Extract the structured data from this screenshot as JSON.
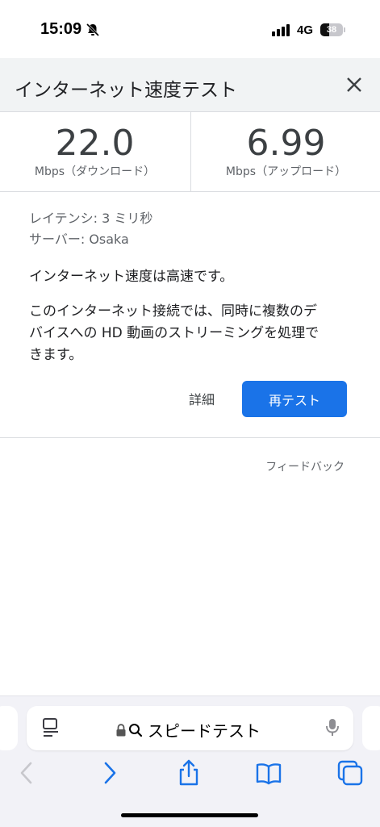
{
  "status_bar": {
    "time": "15:09",
    "network": "4G",
    "battery": "38",
    "battery_level": 0.38
  },
  "header": {
    "title": "インターネット速度テスト"
  },
  "results": {
    "download": {
      "value": "22.0",
      "unit": "Mbps（ダウンロード）"
    },
    "upload": {
      "value": "6.99",
      "unit": "Mbps（アップロード）"
    }
  },
  "info": {
    "latency": "レイテンシ: 3 ミリ秒",
    "server": "サーバー: Osaka",
    "summary": "インターネット速度は高速です。",
    "description_lines": [
      "このインターネット接続では、同時に複数のデ",
      "バイスへの HD 動画のストリーミングを処理で",
      "きます。"
    ]
  },
  "actions": {
    "details": "詳細",
    "retest": "再テスト",
    "feedback": "フィードバック"
  },
  "browser": {
    "address_text": "スピードテスト"
  },
  "colors": {
    "accent": "#1a73e8",
    "header_bg": "#f1f3f4",
    "ios_blue": "#1a73e8"
  },
  "icons": [
    "bell-slash-icon",
    "close-icon",
    "reader-icon",
    "lock-icon",
    "search-icon",
    "mic-icon",
    "back-icon",
    "forward-icon",
    "share-icon",
    "bookmarks-icon",
    "tabs-icon"
  ]
}
